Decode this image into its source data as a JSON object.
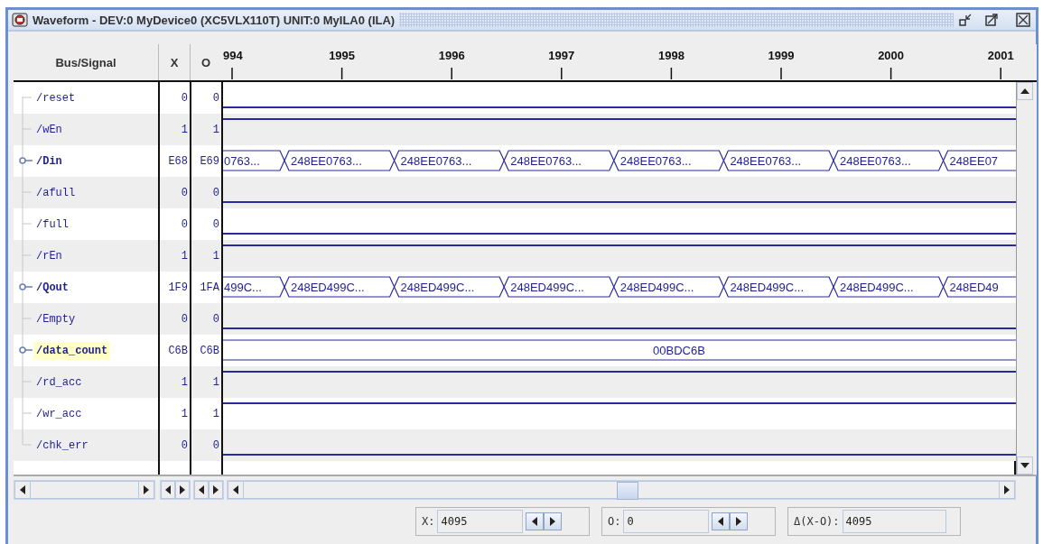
{
  "window": {
    "title": "Waveform - DEV:0 MyDevice0 (XC5VLX110T) UNIT:0 MyILA0 (ILA)"
  },
  "columns": [
    "Bus/Signal",
    "X",
    "O"
  ],
  "timeline": {
    "ticks": [
      "994",
      "1995",
      "1996",
      "1997",
      "1998",
      "1999",
      "2000",
      "2001"
    ]
  },
  "signals": [
    {
      "name": "/reset",
      "kind": "low",
      "x_value": "0",
      "o_value": "0",
      "selected": false
    },
    {
      "name": "/wEn",
      "kind": "high",
      "x_value": "1",
      "o_value": "1",
      "selected": false
    },
    {
      "name": "/Din",
      "kind": "bus",
      "x_value": "E68",
      "o_value": "E69",
      "selected": false,
      "segments": [
        "0763...",
        "248EE0763...",
        "248EE0763...",
        "248EE0763...",
        "248EE0763...",
        "248EE0763...",
        "248EE0763...",
        "248EE07"
      ]
    },
    {
      "name": "/afull",
      "kind": "low",
      "x_value": "0",
      "o_value": "0",
      "selected": false
    },
    {
      "name": "/full",
      "kind": "low",
      "x_value": "0",
      "o_value": "0",
      "selected": false
    },
    {
      "name": "/rEn",
      "kind": "high",
      "x_value": "1",
      "o_value": "1",
      "selected": false
    },
    {
      "name": "/Qout",
      "kind": "bus",
      "x_value": "1F9",
      "o_value": "1FA",
      "selected": false,
      "segments": [
        "499C...",
        "248ED499C...",
        "248ED499C...",
        "248ED499C...",
        "248ED499C...",
        "248ED499C...",
        "248ED499C...",
        "248ED49"
      ]
    },
    {
      "name": "/Empty",
      "kind": "low",
      "x_value": "0",
      "o_value": "0",
      "selected": false
    },
    {
      "name": "/data_count",
      "kind": "bus",
      "x_value": "C6B",
      "o_value": "C6B",
      "selected": true,
      "segments": [
        "00BDC6B"
      ]
    },
    {
      "name": "/rd_acc",
      "kind": "high",
      "x_value": "1",
      "o_value": "1",
      "selected": false
    },
    {
      "name": "/wr_acc",
      "kind": "high",
      "x_value": "1",
      "o_value": "1",
      "selected": false
    },
    {
      "name": "/chk_err",
      "kind": "low",
      "x_value": "0",
      "o_value": "0",
      "selected": false
    }
  ],
  "cursors": [
    {
      "label": "X:",
      "value": "4095",
      "kind": "spin"
    },
    {
      "label": "O:",
      "value": "0",
      "kind": "spin"
    },
    {
      "label": "Δ(X-O):",
      "value": "4095",
      "kind": "plain"
    }
  ]
}
